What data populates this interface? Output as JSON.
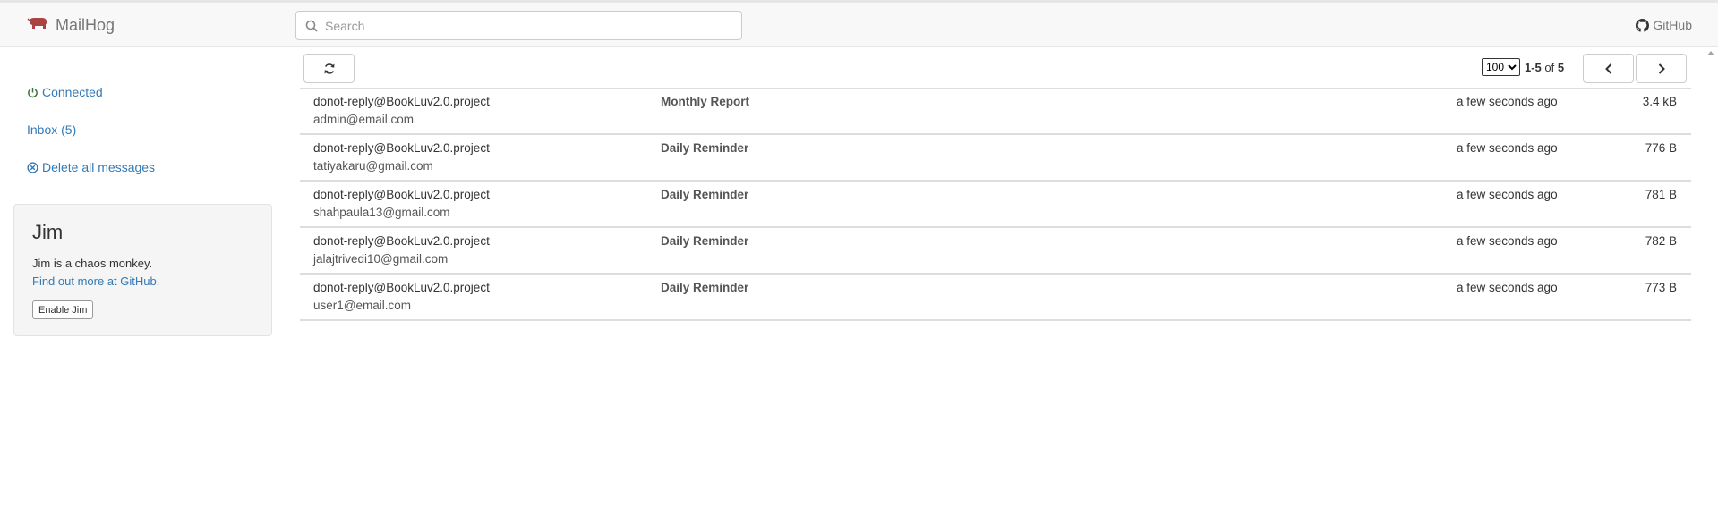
{
  "brand": {
    "name": "MailHog",
    "icon": "pig-icon",
    "accent": "#a94442"
  },
  "search": {
    "placeholder": "Search",
    "value": ""
  },
  "header": {
    "github_label": "GitHub"
  },
  "sidebar": {
    "connected_label": "Connected",
    "inbox_label": "Inbox (5)",
    "delete_label": "Delete all messages",
    "connected_color": "#3c763d",
    "link_color": "#337ab7"
  },
  "jim": {
    "title": "Jim",
    "description": "Jim is a chaos monkey.",
    "link_text": "Find out more at GitHub.",
    "button_label": "Enable Jim"
  },
  "toolbar": {
    "page_size": "100",
    "page_size_options": [
      "100"
    ],
    "range": "1-5",
    "of_label": "of",
    "total": "5"
  },
  "messages": [
    {
      "from": "donot-reply@BookLuv2.0.project",
      "to": "admin@email.com",
      "subject": "Monthly Report",
      "time": "a few seconds ago",
      "size": "3.4 kB"
    },
    {
      "from": "donot-reply@BookLuv2.0.project",
      "to": "tatiyakaru@gmail.com",
      "subject": "Daily Reminder",
      "time": "a few seconds ago",
      "size": "776 B"
    },
    {
      "from": "donot-reply@BookLuv2.0.project",
      "to": "shahpaula13@gmail.com",
      "subject": "Daily Reminder",
      "time": "a few seconds ago",
      "size": "781 B"
    },
    {
      "from": "donot-reply@BookLuv2.0.project",
      "to": "jalajtrivedi10@gmail.com",
      "subject": "Daily Reminder",
      "time": "a few seconds ago",
      "size": "782 B"
    },
    {
      "from": "donot-reply@BookLuv2.0.project",
      "to": "user1@email.com",
      "subject": "Daily Reminder",
      "time": "a few seconds ago",
      "size": "773 B"
    }
  ]
}
